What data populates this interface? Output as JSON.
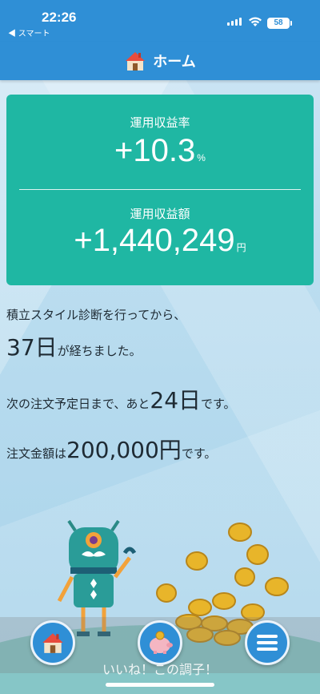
{
  "status": {
    "time": "22:26",
    "back_app": "◀ スマート",
    "battery": "58"
  },
  "nav": {
    "title": "ホーム",
    "icon": "house-icon"
  },
  "stats": {
    "return_rate_label": "運用収益率",
    "return_rate_value": "+10.3",
    "return_rate_unit": "%",
    "return_amount_label": "運用収益額",
    "return_amount_value": "+1,440,249",
    "return_amount_unit": "円"
  },
  "info": {
    "line1": "積立スタイル診断を行ってから、",
    "days_elapsed": "37日",
    "days_elapsed_suffix": "が経ちました。",
    "next_order_prefix": "次の注文予定日まで、あと",
    "days_until": "24日",
    "next_order_suffix": "です。",
    "amount_prefix": "注文金額は",
    "amount_value": "200,000円",
    "amount_suffix": "です。"
  },
  "footer": {
    "text": "いいね！この調子！"
  },
  "tabs": [
    {
      "icon": "house-icon"
    },
    {
      "icon": "piggy-bank-icon"
    },
    {
      "icon": "menu-icon"
    }
  ],
  "colors": {
    "header": "#2f8fd6",
    "card": "#1fb7a3"
  }
}
